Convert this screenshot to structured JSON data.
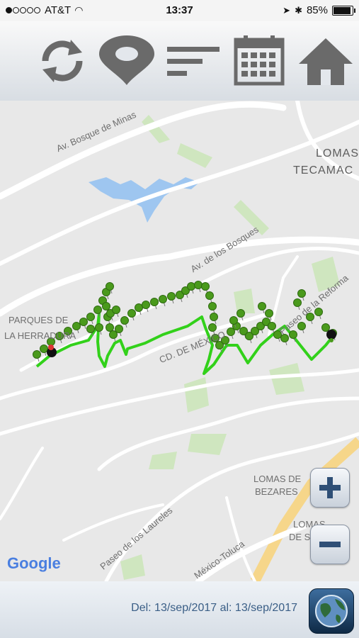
{
  "status": {
    "carrier": "AT&T",
    "time": "13:37",
    "battery": "85%"
  },
  "toolbar": {
    "buttons": [
      {
        "name": "refresh",
        "icon": "refresh-icon"
      },
      {
        "name": "location",
        "icon": "location-pin-icon"
      },
      {
        "name": "menu",
        "icon": "menu-lines-icon"
      },
      {
        "name": "calendar",
        "icon": "calendar-icon"
      },
      {
        "name": "home",
        "icon": "home-icon"
      }
    ]
  },
  "map": {
    "labels": {
      "bosque_minas": "Av. Bosque de Minas",
      "lomas": "LOMAS",
      "tecamac": "TECAMAC",
      "bosques": "Av. de los Bosques",
      "parques_1": "PARQUES DE",
      "parques_2": "LA HERRADURA",
      "cd_mexico": "CD. DE MÉXICO",
      "reforma": "Paseo de la Reforma",
      "bezares_1": "LOMAS DE",
      "bezares_2": "BEZARES",
      "lomas2_1": "LOMAS",
      "lomas2_2": "DE S",
      "laureles": "Paseo de los Laureles",
      "toluca": "México-Toluca"
    },
    "attribution": "Google",
    "colors": {
      "route": "#32d11a",
      "pin": "#4a9a1c",
      "park": "#cfe6bf",
      "water": "#9ec6f0"
    }
  },
  "zoom": {
    "in": "+",
    "out": "−"
  },
  "footer": {
    "date_range": "Del: 13/sep/2017 al: 13/sep/2017",
    "globe_icon": "globe-icon"
  }
}
